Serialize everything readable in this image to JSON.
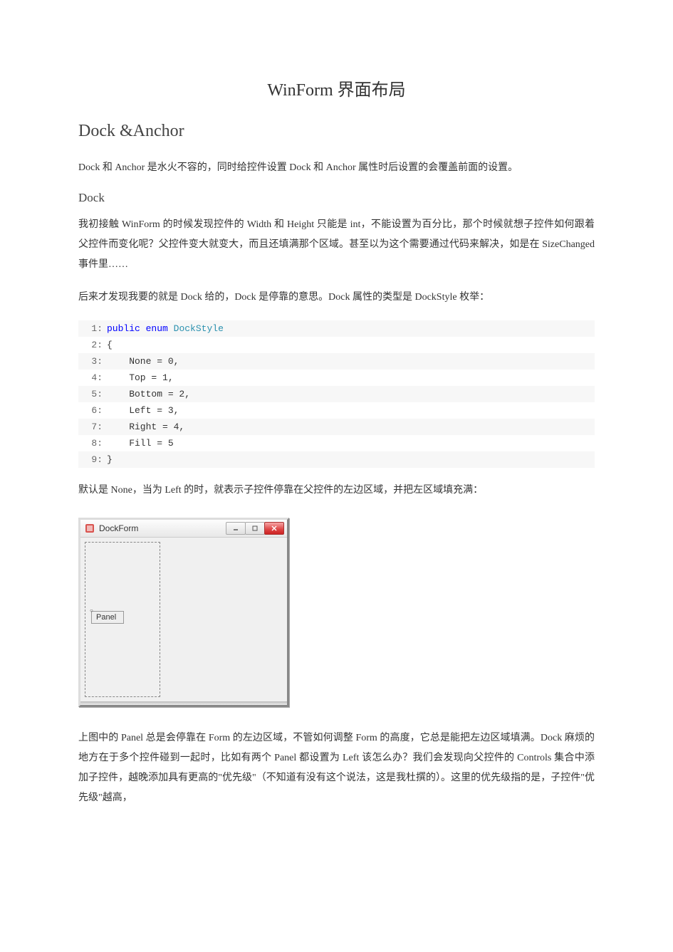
{
  "title": "WinForm 界面布局",
  "heading_dock_anchor": "Dock &Anchor",
  "para1": "Dock 和 Anchor 是水火不容的，同时给控件设置 Dock 和 Anchor 属性时后设置的会覆盖前面的设置。",
  "heading_dock": "Dock",
  "para2": "我初接触 WinForm 的时候发现控件的 Width 和 Height 只能是 int，不能设置为百分比，那个时候就想子控件如何跟着父控件而变化呢？父控件变大就变大，而且还填满那个区域。甚至以为这个需要通过代码来解决，如是在 SizeChanged 事件里……",
  "para3": "后来才发现我要的就是 Dock 给的，Dock 是停靠的意思。Dock 属性的类型是 DockStyle 枚举：",
  "code": {
    "lines": [
      {
        "n": "1:",
        "prefix": "",
        "kw1": "public",
        "kw2": "enum",
        "typ": "DockStyle",
        "rest": ""
      },
      {
        "n": "2:",
        "prefix": "",
        "kw1": "",
        "kw2": "",
        "typ": "",
        "rest": "{"
      },
      {
        "n": "3:",
        "prefix": "    ",
        "kw1": "",
        "kw2": "",
        "typ": "",
        "rest": "None = 0,"
      },
      {
        "n": "4:",
        "prefix": "    ",
        "kw1": "",
        "kw2": "",
        "typ": "",
        "rest": "Top = 1,"
      },
      {
        "n": "5:",
        "prefix": "    ",
        "kw1": "",
        "kw2": "",
        "typ": "",
        "rest": "Bottom = 2,"
      },
      {
        "n": "6:",
        "prefix": "    ",
        "kw1": "",
        "kw2": "",
        "typ": "",
        "rest": "Left = 3,"
      },
      {
        "n": "7:",
        "prefix": "    ",
        "kw1": "",
        "kw2": "",
        "typ": "",
        "rest": "Right = 4,"
      },
      {
        "n": "8:",
        "prefix": "    ",
        "kw1": "",
        "kw2": "",
        "typ": "",
        "rest": "Fill = 5"
      },
      {
        "n": "9:",
        "prefix": "",
        "kw1": "",
        "kw2": "",
        "typ": "",
        "rest": "}"
      }
    ]
  },
  "para4": "默认是 None，当为 Left 的时，就表示子控件停靠在父控件的左边区域，并把左区域填充满：",
  "window": {
    "title": "DockForm",
    "panel_label": "Panel"
  },
  "para5": "上图中的 Panel 总是会停靠在 Form 的左边区域，不管如何调整 Form 的高度，它总是能把左边区域填满。Dock 麻烦的地方在于多个控件碰到一起时，比如有两个 Panel 都设置为 Left 该怎么办？我们会发现向父控件的 Controls 集合中添加子控件，越晚添加具有更高的\"优先级\"（不知道有没有这个说法，这是我杜撰的）。这里的优先级指的是，子控件\"优先级\"越高，"
}
